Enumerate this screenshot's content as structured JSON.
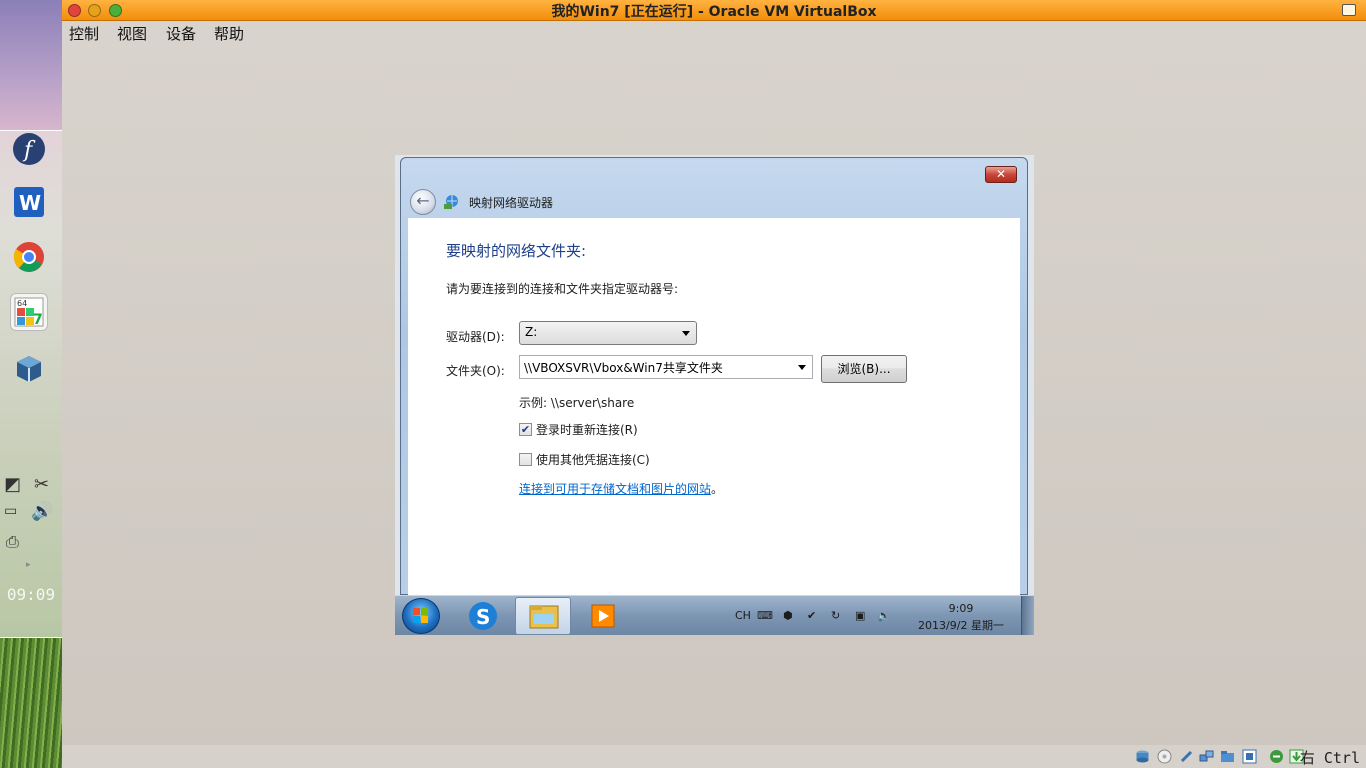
{
  "vbox": {
    "title": "我的Win7 [正在运行] - Oracle VM VirtualBox",
    "menu": [
      "控制",
      "视图",
      "设备",
      "帮助"
    ],
    "host_key": "右 Ctrl"
  },
  "dock": {
    "clock": "09:09",
    "apps": [
      "fedora-icon",
      "wps-writer-icon",
      "chrome-icon",
      "win7-vm-icon",
      "virtualbox-icon"
    ]
  },
  "dialog": {
    "title": "映射网络驱动器",
    "close": "✕",
    "heading": "要映射的网络文件夹:",
    "instruction": "请为要连接到的连接和文件夹指定驱动器号:",
    "drive_label": "驱动器(D):",
    "drive_value": "Z:",
    "folder_label": "文件夹(O):",
    "folder_value": "\\\\VBOXSVR\\Vbox&Win7共享文件夹",
    "browse": "浏览(B)...",
    "example": "示例: \\\\server\\share",
    "reconnect_label": "登录时重新连接(R)",
    "reconnect_checked": true,
    "credentials_label": "使用其他凭据连接(C)",
    "credentials_checked": false,
    "link": "连接到可用于存储文档和图片的网站",
    "link_suffix": "。"
  },
  "guest_taskbar": {
    "lang": "CH",
    "time": "9:09",
    "date": "2013/9/2 星期一"
  }
}
